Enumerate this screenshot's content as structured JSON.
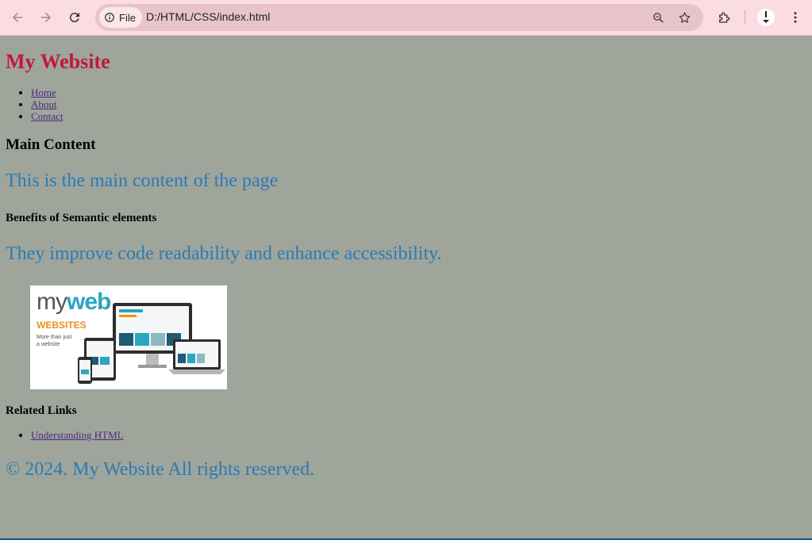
{
  "browser": {
    "file_chip": "File",
    "url": "D:/HTML/CSS/index.html",
    "colors": {
      "toolbar": "#fbdce3",
      "omnibox": "#e8c4ca"
    }
  },
  "page": {
    "site_title": "My Website",
    "nav": [
      "Home",
      "About",
      "Contact"
    ],
    "main_heading": "Main Content",
    "main_text": "This is the main content of the page",
    "sub_heading": "Benefits of Semantic elements",
    "sub_text": "They improve code readability and enhance accessibility.",
    "image": {
      "brand_my": "my",
      "brand_web": "web",
      "brand_sub": "WEBSITES",
      "brand_tag": "More than just\na website"
    },
    "related_heading": "Related Links",
    "related_links": [
      "Understanding HTML"
    ],
    "footer": "© 2024. My Website All rights reserved.",
    "colors": {
      "background": "#9fa59b",
      "title": "#c0183b",
      "text_blue": "#2a7bb6",
      "link": "#4c2a82"
    }
  }
}
